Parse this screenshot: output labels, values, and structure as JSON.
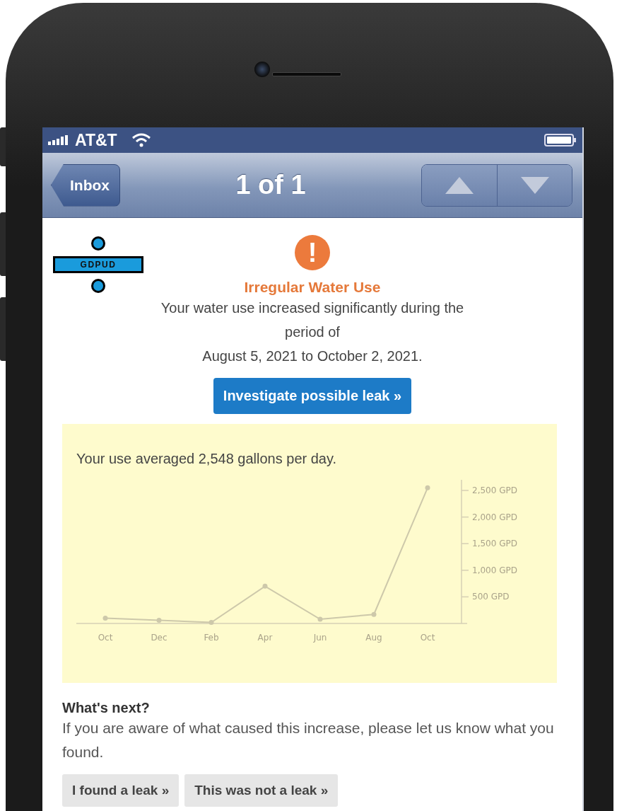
{
  "status_bar": {
    "carrier": "AT&T"
  },
  "nav": {
    "back": "Inbox",
    "title": "1 of 1"
  },
  "logo": {
    "text": "GDPUD"
  },
  "alert": {
    "icon": "!",
    "title": "Irregular Water Use",
    "message_lines": [
      "Your water use increased significantly during the",
      "period of",
      "August 5, 2021 to October 2, 2021."
    ],
    "action": "Investigate possible leak »"
  },
  "usage": {
    "summary": "Your use averaged 2,548 gallons per day.",
    "chart_data": {
      "type": "line",
      "categories": [
        "Oct",
        "Dec",
        "Feb",
        "Apr",
        "Jun",
        "Aug",
        "Oct"
      ],
      "series": [
        {
          "color": "#cdc8aa",
          "marker": "circle",
          "values": [
            100,
            60,
            20,
            700,
            80,
            170,
            2550
          ]
        }
      ],
      "ylim": [
        0,
        2700
      ],
      "yticks": [
        {
          "value": 500,
          "label": "500 GPD"
        },
        {
          "value": 1000,
          "label": "1,000 GPD"
        },
        {
          "value": 1500,
          "label": "1,500 GPD"
        },
        {
          "value": 2000,
          "label": "2,000 GPD"
        },
        {
          "value": 2500,
          "label": "2,500 GPD"
        }
      ]
    }
  },
  "next": {
    "heading": "What's next?",
    "text": "If you are aware of what caused this increase, please let us know what you found.",
    "buttons": [
      "I found a leak »",
      "This was not a leak »"
    ]
  }
}
